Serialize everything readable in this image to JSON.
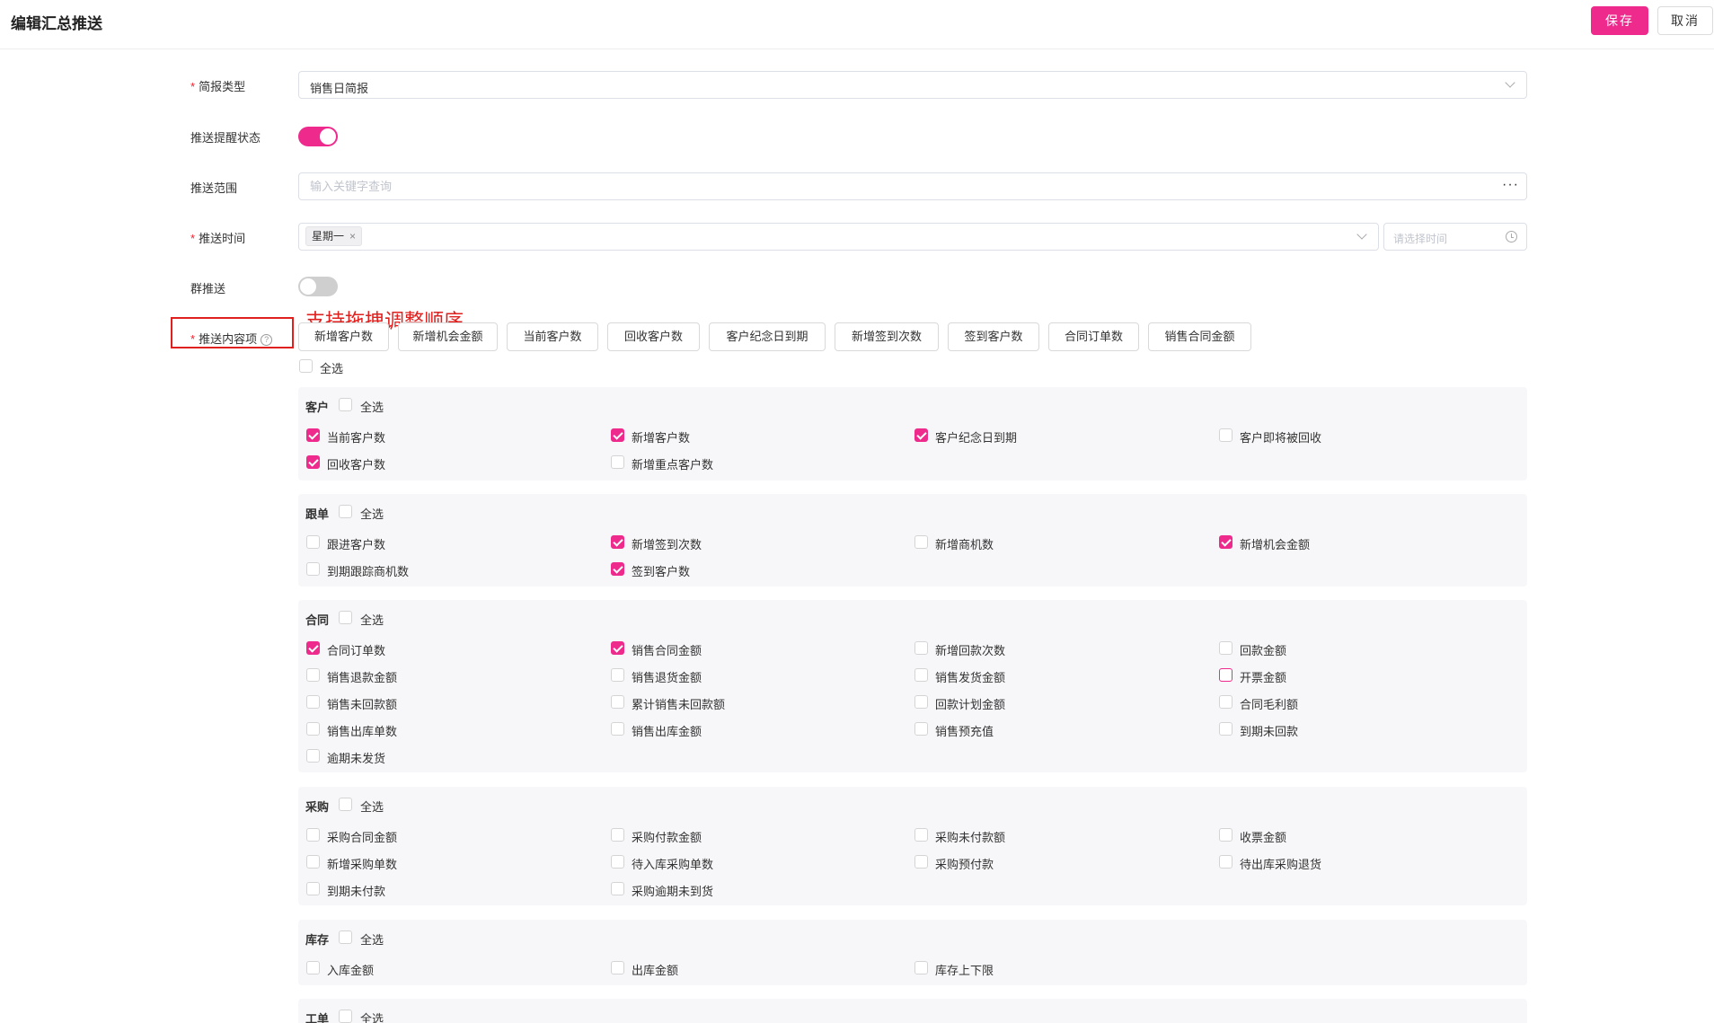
{
  "header": {
    "title": "编辑汇总推送",
    "save_label": "保存",
    "cancel_label": "取消"
  },
  "form": {
    "report_type": {
      "label": "简报类型",
      "value": "销售日简报"
    },
    "remind_status": {
      "label": "推送提醒状态",
      "on": true
    },
    "push_scope": {
      "label": "推送范围",
      "placeholder": "输入关键字查询",
      "more_label": "···"
    },
    "push_time": {
      "label": "推送时间",
      "tag": "星期一",
      "tag_close": "×",
      "time_placeholder": "请选择时间"
    },
    "group_push": {
      "label": "群推送",
      "on": false
    },
    "content": {
      "label": "推送内容项",
      "help": "?",
      "annotation": "支持拖拽调整顺序",
      "chips": [
        "新增客户数",
        "新增机会金额",
        "当前客户数",
        "回收客户数",
        "客户纪念日到期",
        "新增签到次数",
        "签到客户数",
        "合同订单数",
        "销售合同金额"
      ],
      "select_all": "全选"
    }
  },
  "groups": [
    {
      "title": "客户",
      "select_all": "全选",
      "items": [
        {
          "label": "当前客户数",
          "checked": true
        },
        {
          "label": "新增客户数",
          "checked": true
        },
        {
          "label": "客户纪念日到期",
          "checked": true
        },
        {
          "label": "客户即将被回收",
          "checked": false
        },
        {
          "label": "回收客户数",
          "checked": true
        },
        {
          "label": "新增重点客户数",
          "checked": false
        }
      ]
    },
    {
      "title": "跟单",
      "select_all": "全选",
      "items": [
        {
          "label": "跟进客户数",
          "checked": false
        },
        {
          "label": "新增签到次数",
          "checked": true
        },
        {
          "label": "新增商机数",
          "checked": false
        },
        {
          "label": "新增机会金额",
          "checked": true
        },
        {
          "label": "到期跟踪商机数",
          "checked": false
        },
        {
          "label": "签到客户数",
          "checked": true
        }
      ]
    },
    {
      "title": "合同",
      "select_all": "全选",
      "items": [
        {
          "label": "合同订单数",
          "checked": true
        },
        {
          "label": "销售合同金额",
          "checked": true
        },
        {
          "label": "新增回款次数",
          "checked": false
        },
        {
          "label": "回款金额",
          "checked": false
        },
        {
          "label": "销售退款金额",
          "checked": false
        },
        {
          "label": "销售退货金额",
          "checked": false
        },
        {
          "label": "销售发货金额",
          "checked": false
        },
        {
          "label": "开票金额",
          "checked": false,
          "hover": true
        },
        {
          "label": "销售未回款额",
          "checked": false
        },
        {
          "label": "累计销售未回款额",
          "checked": false
        },
        {
          "label": "回款计划金额",
          "checked": false
        },
        {
          "label": "合同毛利额",
          "checked": false
        },
        {
          "label": "销售出库单数",
          "checked": false
        },
        {
          "label": "销售出库金额",
          "checked": false
        },
        {
          "label": "销售预充值",
          "checked": false
        },
        {
          "label": "到期未回款",
          "checked": false
        },
        {
          "label": "逾期未发货",
          "checked": false
        }
      ]
    },
    {
      "title": "采购",
      "select_all": "全选",
      "items": [
        {
          "label": "采购合同金额",
          "checked": false
        },
        {
          "label": "采购付款金额",
          "checked": false
        },
        {
          "label": "采购未付款额",
          "checked": false
        },
        {
          "label": "收票金额",
          "checked": false
        },
        {
          "label": "新增采购单数",
          "checked": false
        },
        {
          "label": "待入库采购单数",
          "checked": false
        },
        {
          "label": "采购预付款",
          "checked": false
        },
        {
          "label": "待出库采购退货",
          "checked": false
        },
        {
          "label": "到期未付款",
          "checked": false
        },
        {
          "label": "采购逾期未到货",
          "checked": false
        }
      ]
    },
    {
      "title": "库存",
      "select_all": "全选",
      "items": [
        {
          "label": "入库金额",
          "checked": false
        },
        {
          "label": "出库金额",
          "checked": false
        },
        {
          "label": "库存上下限",
          "checked": false
        }
      ]
    },
    {
      "title": "工单",
      "select_all": "全选",
      "items": []
    }
  ]
}
